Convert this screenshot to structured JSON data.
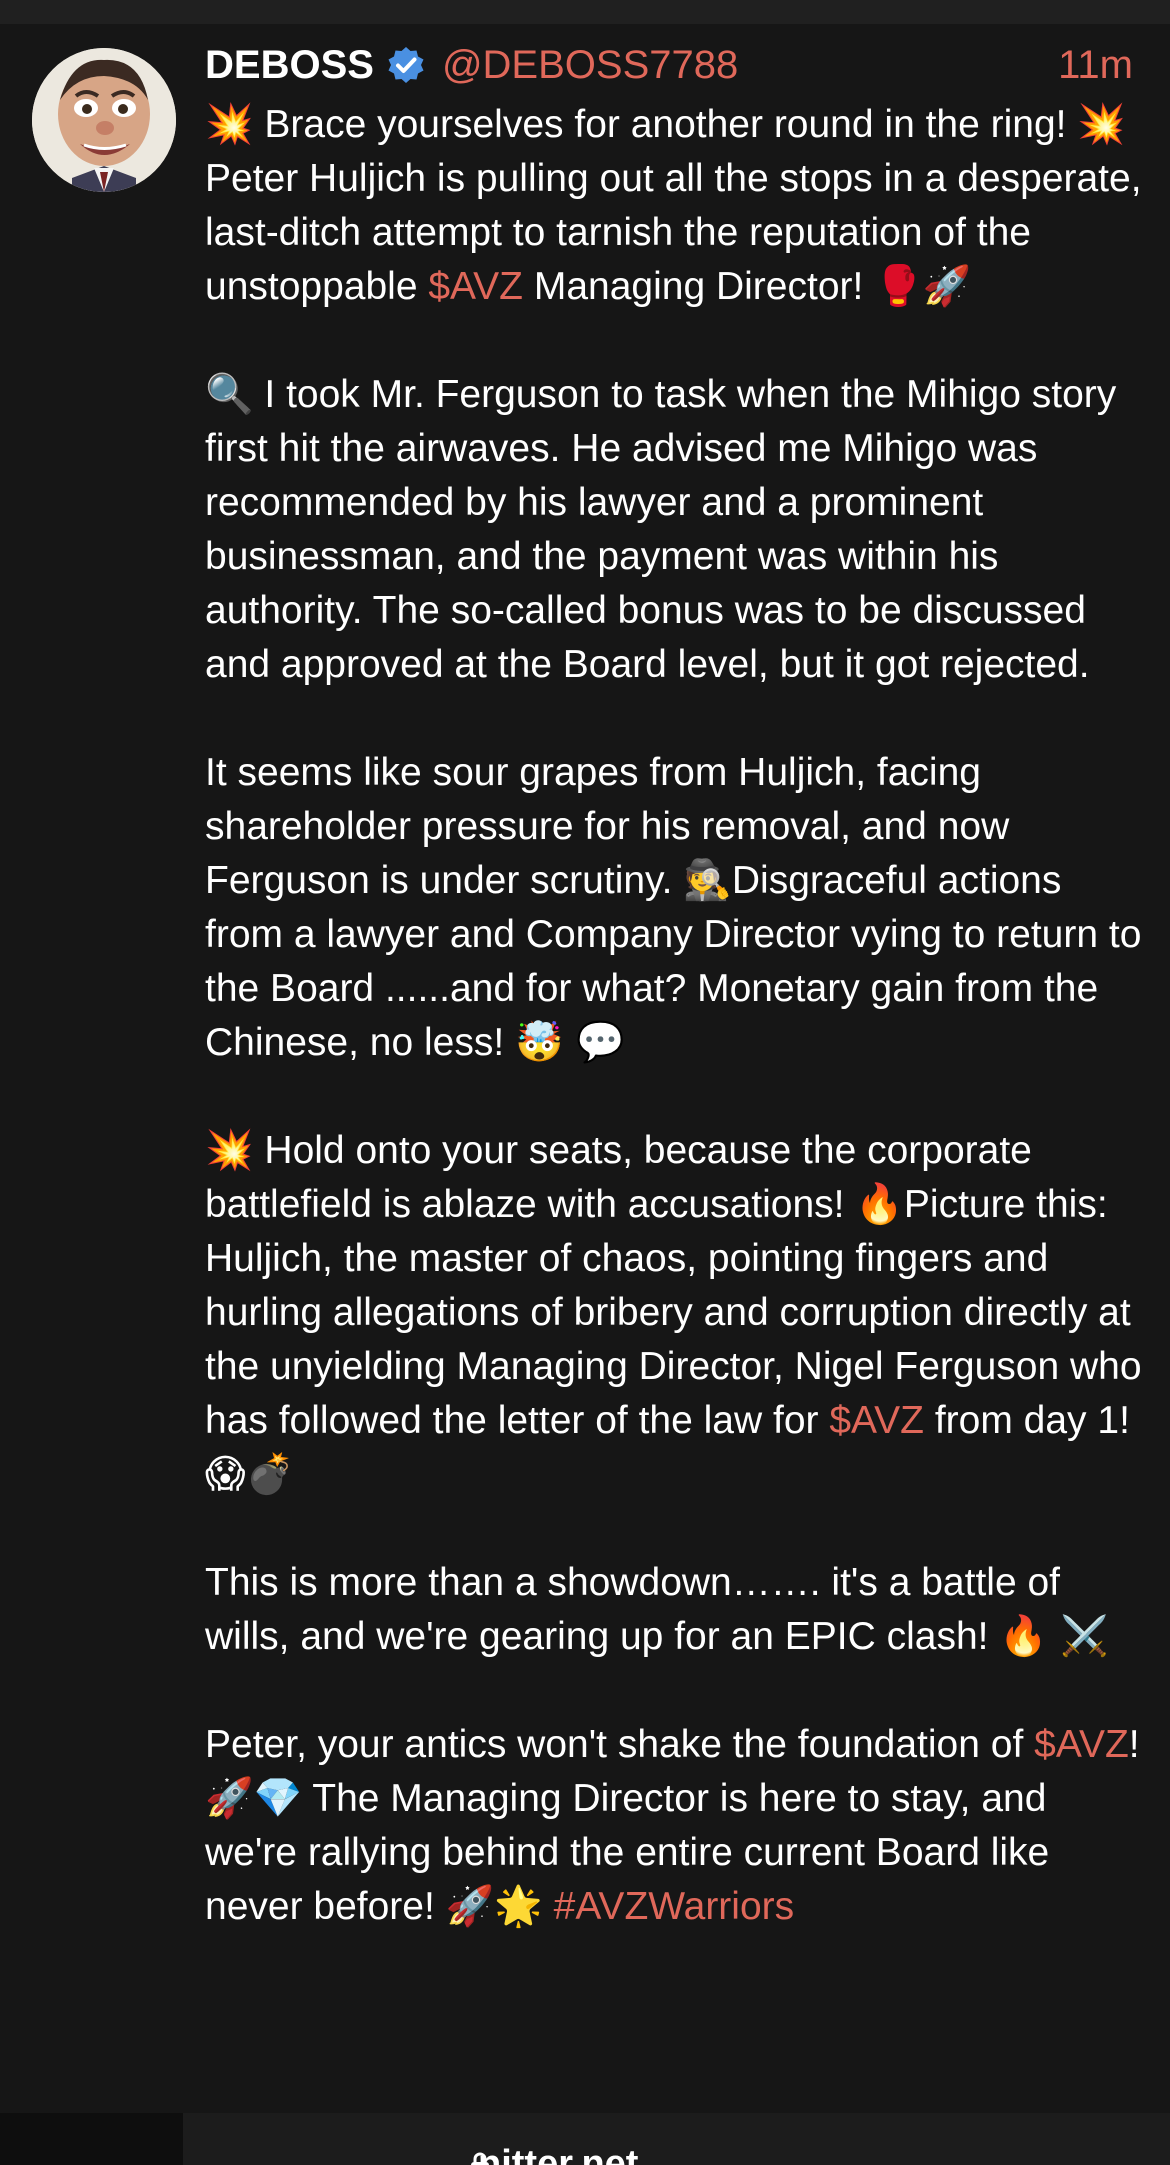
{
  "post": {
    "display_name": "DEBOSS",
    "handle": "@DEBOSS7788",
    "timestamp": "11m",
    "verified": true,
    "verified_badge_color": "#4a90e2",
    "link_color": "#e0685a",
    "paragraphs": [
      [
        {
          "t": "💥",
          "k": "emoji"
        },
        {
          "t": " Brace yourselves for another round in the ring! "
        },
        {
          "t": "💥",
          "k": "emoji"
        },
        {
          "t": " Peter Huljich is pulling out all the stops in a desperate, last-ditch attempt to tarnish the reputation of the unstoppable "
        },
        {
          "t": "$AVZ",
          "k": "link"
        },
        {
          "t": " Managing Director! "
        },
        {
          "t": "🥊🚀",
          "k": "emoji"
        }
      ],
      [
        {
          "t": "🔍",
          "k": "emoji"
        },
        {
          "t": " I took Mr. Ferguson to task when the Mihigo story first hit the airwaves. He advised me Mihigo was recommended by his lawyer and a prominent businessman, and the payment was within his authority. The so-called bonus was to be discussed and approved at the Board level, but it got rejected."
        }
      ],
      [
        {
          "t": "It seems like sour grapes from Huljich, facing shareholder pressure for his removal, and now Ferguson is under scrutiny. "
        },
        {
          "t": "🕵️",
          "k": "emoji"
        },
        {
          "t": "Disgraceful actions from a lawyer and Company Director vying to return to the Board ......and for what? Monetary gain from the Chinese, no less! "
        },
        {
          "t": "🤯 💬",
          "k": "emoji"
        }
      ],
      [
        {
          "t": "💥",
          "k": "emoji"
        },
        {
          "t": " Hold onto your seats, because the corporate battlefield is ablaze with accusations! "
        },
        {
          "t": "🔥",
          "k": "emoji"
        },
        {
          "t": "Picture this: Huljich, the master of chaos, pointing fingers and hurling allegations of bribery and corruption directly at the unyielding Managing Director, Nigel Ferguson who has followed the letter of the law for "
        },
        {
          "t": "$AVZ",
          "k": "link"
        },
        {
          "t": " from day 1! "
        },
        {
          "t": "😱💣",
          "k": "emoji"
        }
      ],
      [
        {
          "t": "This is more than a showdown……. it's a battle of wills, and we're gearing up for an EPIC clash! "
        },
        {
          "t": "🔥 ⚔️",
          "k": "emoji"
        }
      ],
      [
        {
          "t": "Peter, your antics won't shake the foundation of "
        },
        {
          "t": "$AVZ",
          "k": "link"
        },
        {
          "t": "! "
        },
        {
          "t": "🚀💎",
          "k": "emoji"
        },
        {
          "t": " The Managing Director is here to stay, and we're rallying behind the entire current Board like never before! "
        },
        {
          "t": "🚀🌟",
          "k": "emoji"
        },
        {
          "t": " "
        },
        {
          "t": "#AVZWarriors",
          "k": "tag"
        }
      ]
    ]
  },
  "footer": {
    "site": "nitter.net",
    "icon": "lock-icon"
  }
}
